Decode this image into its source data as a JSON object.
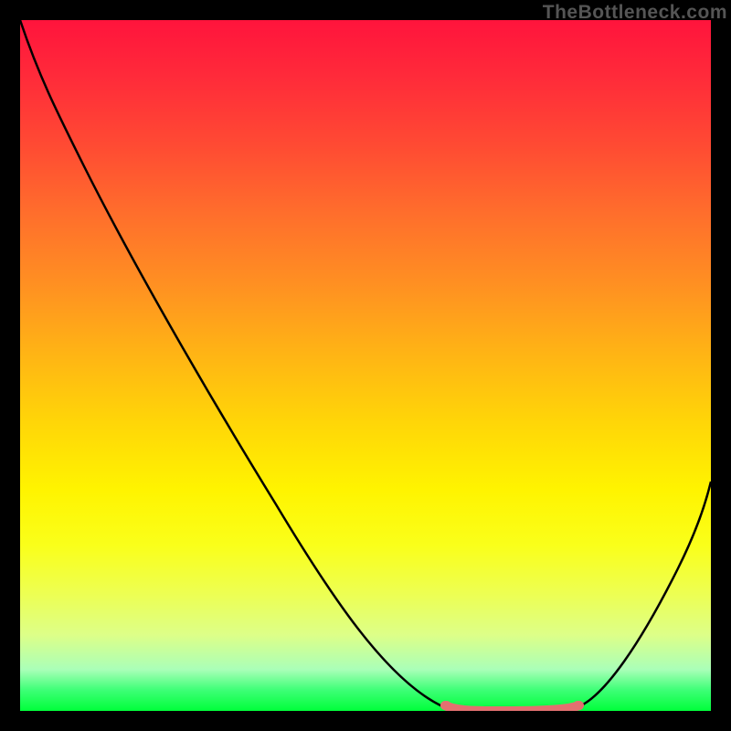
{
  "watermark": "TheBottleneck.com",
  "chart_data": {
    "type": "line",
    "title": "",
    "xlabel": "",
    "ylabel": "",
    "xlim": [
      0,
      100
    ],
    "ylim": [
      0,
      100
    ],
    "series": [
      {
        "name": "bottleneck-curve",
        "x": [
          0,
          5,
          10,
          15,
          20,
          25,
          30,
          35,
          40,
          45,
          50,
          55,
          60,
          63,
          67,
          70,
          73,
          76,
          79,
          82,
          85,
          90,
          95,
          100
        ],
        "y": [
          100,
          95,
          88,
          80,
          72,
          64,
          56,
          48,
          40,
          32,
          24,
          16,
          9,
          4,
          1,
          0,
          0,
          0,
          0,
          1,
          4,
          12,
          24,
          40
        ]
      },
      {
        "name": "highlight-band",
        "x": [
          63,
          79
        ],
        "y": [
          0,
          0
        ]
      }
    ],
    "gradient": {
      "top": "#ff143c",
      "middle": "#fff400",
      "bottom": "#00ff3a"
    }
  }
}
